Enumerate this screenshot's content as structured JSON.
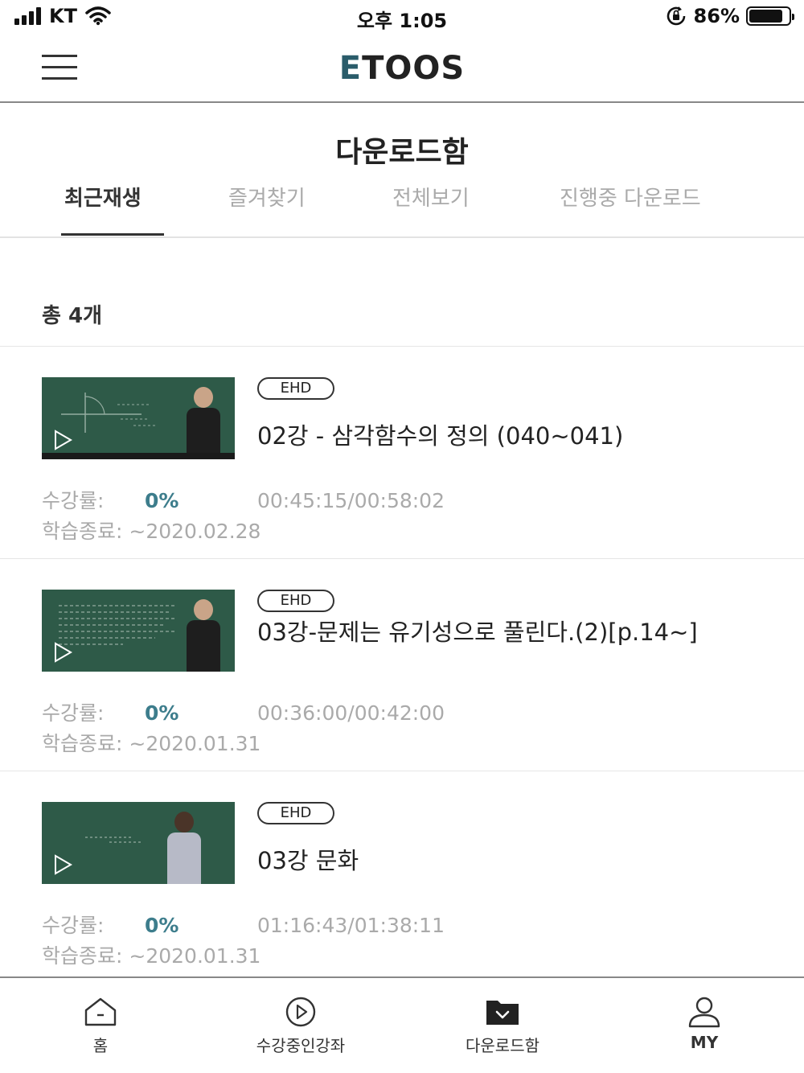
{
  "status_bar": {
    "carrier": "KT",
    "time": "오후 1:05",
    "battery_percent": "86%",
    "battery_level": 0.86
  },
  "header": {
    "logo_accent": "E",
    "logo_rest": "TOOS",
    "accent_color": "#2a5c6a"
  },
  "page": {
    "title": "다운로드함",
    "tabs": [
      {
        "label": "최근재생",
        "active": true
      },
      {
        "label": "즐겨찾기",
        "active": false
      },
      {
        "label": "전체보기",
        "active": false
      },
      {
        "label": "진행중 다운로드",
        "active": false
      }
    ],
    "total_count": "총 4개"
  },
  "lectures": [
    {
      "badge": "EHD",
      "title": "02강 - 삼각함수의 정의 (040~041)",
      "progress_label": "수강률:",
      "progress_value": "0%",
      "time": "00:45:15/00:58:02",
      "end_date": "학습종료: ~2020.02.28"
    },
    {
      "badge": "EHD",
      "title": "03강-문제는 유기성으로 풀린다.(2)[p.14~]",
      "progress_label": "수강률:",
      "progress_value": "0%",
      "time": "00:36:00/00:42:00",
      "end_date": "학습종료: ~2020.01.31"
    },
    {
      "badge": "EHD",
      "title": "03강 문화",
      "progress_label": "수강률:",
      "progress_value": "0%",
      "time": "01:16:43/01:38:11",
      "end_date": "학습종료: ~2020.01.31"
    }
  ],
  "bottom_nav": [
    {
      "label": "홈",
      "icon": "home-icon"
    },
    {
      "label": "수강중인강좌",
      "icon": "play-circle-icon"
    },
    {
      "label": "다운로드함",
      "icon": "download-folder-icon",
      "active": true
    },
    {
      "label": "MY",
      "icon": "user-icon"
    }
  ]
}
